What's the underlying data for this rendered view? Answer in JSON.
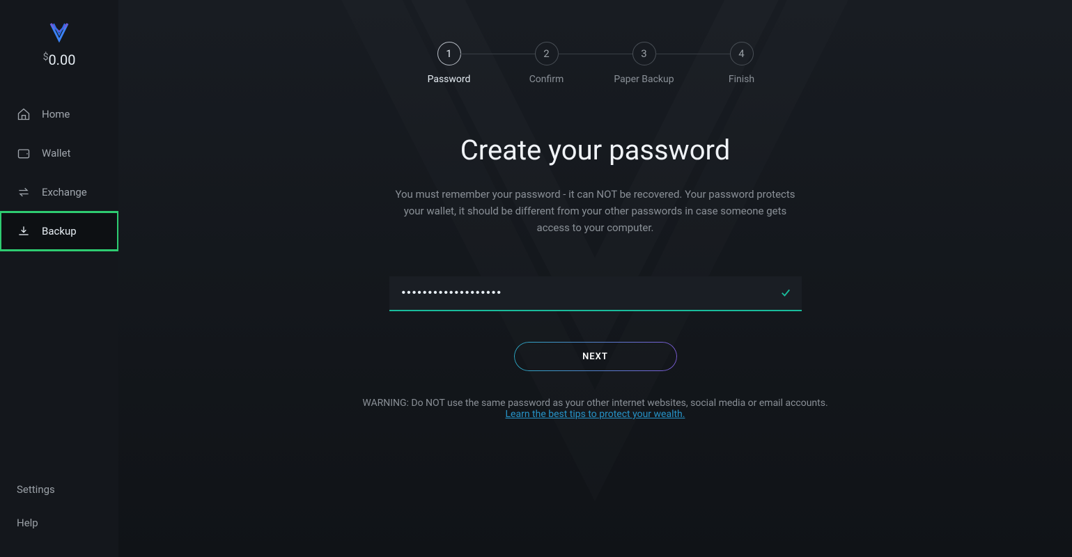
{
  "sidebar": {
    "currency_symbol": "$",
    "balance": "0.00",
    "nav": [
      {
        "label": "Home"
      },
      {
        "label": "Wallet"
      },
      {
        "label": "Exchange"
      },
      {
        "label": "Backup"
      }
    ],
    "bottom": [
      {
        "label": "Settings"
      },
      {
        "label": "Help"
      }
    ]
  },
  "steps": [
    {
      "num": "1",
      "label": "Password"
    },
    {
      "num": "2",
      "label": "Confirm"
    },
    {
      "num": "3",
      "label": "Paper Backup"
    },
    {
      "num": "4",
      "label": "Finish"
    }
  ],
  "main": {
    "title": "Create your password",
    "description": "You must remember your password - it can NOT be recovered. Your password protects your wallet, it should be different from your other passwords in case someone gets access to your computer.",
    "password_value": "•••••••••••••••••••",
    "next_label": "NEXT",
    "warning": "WARNING: Do NOT use the same password as your other internet websites, social media or email accounts.",
    "tips_link": "Learn the best tips to protect your wealth."
  },
  "colors": {
    "accent_teal": "#1abc9c",
    "highlight_green": "#2ecc71",
    "link_blue": "#2693c8",
    "gradient_start": "#2ba8c4",
    "gradient_end": "#7b5bd6"
  }
}
